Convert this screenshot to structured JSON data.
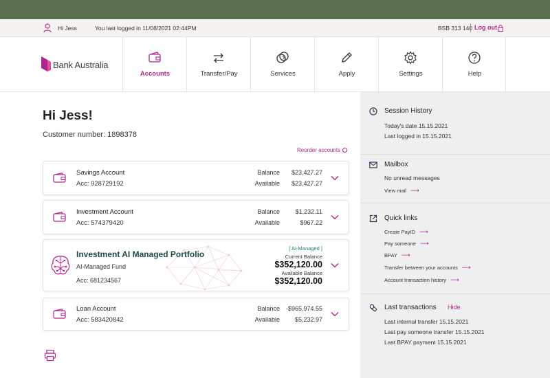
{
  "userbar": {
    "greeting": "Hi Jess",
    "last_login": "You last logged in 11/08/2021 02:44PM",
    "bsb": "BSB 313 140",
    "logout": "Log out"
  },
  "brand": {
    "name": "Bank Australia",
    "accent": "#b0268c",
    "dark_teal": "#1f4a47"
  },
  "nav": {
    "items": [
      {
        "label": "Accounts",
        "icon": "wallet-icon"
      },
      {
        "label": "Transfer/Pay",
        "icon": "transfer-arrows-icon"
      },
      {
        "label": "Services",
        "icon": "coins-icon"
      },
      {
        "label": "Apply",
        "icon": "pencil-icon"
      },
      {
        "label": "Settings",
        "icon": "gear-icon"
      },
      {
        "label": "Help",
        "icon": "help-icon"
      }
    ]
  },
  "main": {
    "greeting": "Hi Jess!",
    "customer_number": "Customer number: 1898378",
    "reorder": "Reorder accounts"
  },
  "accounts": [
    {
      "name": "Savings Account",
      "acc": "Acc: 928729192",
      "balance_label": "Balance",
      "balance": "$23,427.27",
      "available_label": "Available",
      "available": "$23,427.27"
    },
    {
      "name": "Investment Account",
      "acc": "Acc: 574379420",
      "balance_label": "Balance",
      "balance": "$1,232.11",
      "available_label": "Available",
      "available": "$967.22"
    },
    {
      "name": "Loan Account",
      "acc": "Acc: 583420842",
      "balance_label": "Balance",
      "balance": "-$965,974.55",
      "available_label": "Available",
      "available": "$5,232.97"
    }
  ],
  "ai_portfolio": {
    "title": "Investment AI Managed Portfolio",
    "subtitle": "AI-Managed Fund",
    "acc": "Acc: 681234567",
    "badge": "[ AI-Managed ]",
    "current_label": "Current Balance",
    "current_balance": "$352,120.00",
    "available_label": "Available Balance",
    "available_balance": "$352,120.00"
  },
  "sidebar": {
    "session": {
      "title": "Session History",
      "today": "Today's date  15.15.2021",
      "last_logged": "Last logged in  15.15.2021"
    },
    "mailbox": {
      "title": "Mailbox",
      "message": "No unread messages",
      "link": "View mail"
    },
    "quick_links": {
      "title": "Quick links",
      "items": [
        "Create PayID",
        "Pay someone",
        "BPAY",
        "Transfer between your accounts",
        "Account transaction history"
      ]
    },
    "last_transactions": {
      "title": "Last transactions",
      "hide": "Hide",
      "items": [
        "Last internal transfer  15.15.2021",
        "Last pay someone transfer  15.15.2021",
        "Last BPAY payment  15.15.2021"
      ]
    }
  }
}
